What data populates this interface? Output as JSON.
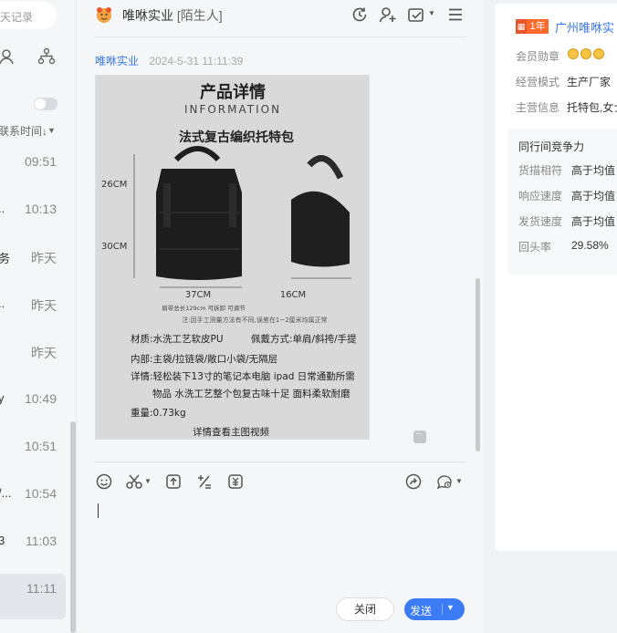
{
  "sidebar": {
    "search_placeholder": "天记录",
    "sort_label": "联系时间↓",
    "rows": [
      {
        "name": "",
        "time": "09:51"
      },
      {
        "name": "..",
        "time": "10:13"
      },
      {
        "name": "务",
        "time": "昨天"
      },
      {
        "name": "..",
        "time": "昨天"
      },
      {
        "name": "",
        "time": "昨天"
      },
      {
        "name": "y",
        "time": "10:49"
      },
      {
        "name": "",
        "time": "10:51"
      },
      {
        "name": "/...",
        "time": "10:54"
      },
      {
        "name": "3",
        "time": "11:03"
      },
      {
        "name": "",
        "time": "11:11"
      }
    ]
  },
  "chat": {
    "title": "唯咻实业",
    "subtitle": "[陌生人]",
    "message": {
      "sender": "唯咻实业",
      "time": "2024-5-31 11:11:39",
      "image": {
        "heading": "产品详情",
        "heading_en": "INFORMATION",
        "product": "法式复古编织托特包",
        "dim_height": "26CM",
        "dim_depth": "30CM",
        "dim_width": "37CM",
        "dim_side": "16CM",
        "strap_note": "肩带总长129cm 可拆卸 可调节",
        "measure_note": "注:因手工测量方法有不同,误差在1~2厘米均属正常",
        "material": "材质:水洗工艺软皮PU",
        "carry": "佩戴方式:单肩/斜挎/手提",
        "inner": "内部:主袋/拉链袋/敞口小袋/无隔层",
        "detail1": "详情:轻松装下13寸的笔记本电脑 ipad 日常通勤所需",
        "detail2": "物品 水洗工艺整个包复古味十足 面料柔软耐磨",
        "weight": "重量:0.73kg",
        "video": "详情查看主图视频"
      }
    },
    "close_label": "关闭",
    "send_label": "发送"
  },
  "profile": {
    "year_badge": "1年",
    "company": "广州唯咻实",
    "medal_label": "会员勋章",
    "mode_label": "经营模式",
    "mode_value": "生产厂家",
    "main_label": "主营信息",
    "main_value": "托特包,女士",
    "competition": {
      "title": "同行间竞争力",
      "items": [
        {
          "label": "货描相符",
          "value": "高于均值"
        },
        {
          "label": "响应速度",
          "value": "高于均值"
        },
        {
          "label": "发货速度",
          "value": "高于均值"
        },
        {
          "label": "回头率",
          "value": "29.58%"
        }
      ]
    }
  },
  "colors": {
    "accent": "#3b7cf5",
    "link": "#3b78e7",
    "badge": "#ff6a2c"
  }
}
